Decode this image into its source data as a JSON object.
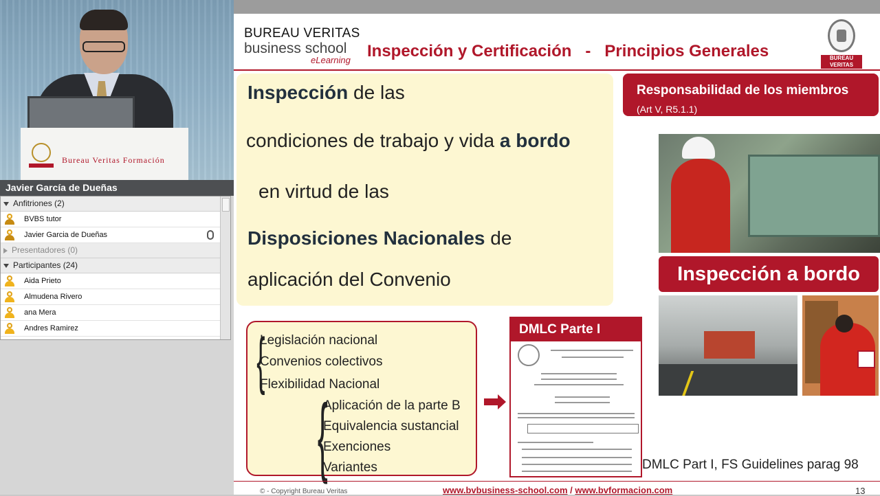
{
  "presenter": {
    "name": "Javier García de Dueñas",
    "lectern_text": "Bureau Veritas Formación"
  },
  "attendees": {
    "groups": [
      {
        "label": "Anfitriones (2)",
        "expanded": true,
        "muted": false
      },
      {
        "label": "Presentadores (0)",
        "expanded": false,
        "muted": true
      },
      {
        "label": "Participantes (24)",
        "expanded": true,
        "muted": false
      }
    ],
    "hosts": [
      "BVBS tutor",
      "Javier Garcia de Dueñas"
    ],
    "participants": [
      "Aida Prieto",
      "Almudena Rivero",
      "ana Mera",
      "Andres Ramirez"
    ]
  },
  "slide": {
    "brand_line1": "BUREAU VERITAS",
    "brand_line2": "business school",
    "brand_line3": "eLearning",
    "title": "Inspección y Certificación   -   Principios Generales",
    "seal_label": "BUREAU VERITAS",
    "main_text": {
      "l1_bold": "Inspección",
      "l1_rest": " de las",
      "l2_rest": "condiciones de trabajo y vida ",
      "l2_bold": "a bordo",
      "l3": "en virtud de las",
      "l4_bold": "Disposiciones Nacionales",
      "l4_rest": " de",
      "l5": "aplicación del Convenio"
    },
    "resp_title": "Responsabilidad de los miembros",
    "resp_sub": "(Art V, R5.1.1)",
    "inspeccion_label": "Inspección a bordo",
    "list_primary": [
      "Legislación nacional",
      "Convenios colectivos",
      "Flexibilidad Nacional"
    ],
    "list_secondary": [
      "Aplicación de la parte B",
      "Equivalencia sustancial",
      "Exenciones",
      "Variantes"
    ],
    "dmlc_title": "DMLC Parte I",
    "guidelines": "DMLC Part I, FS Guidelines parag 98",
    "copyright": "© - Copyright Bureau Veritas",
    "link1": "www.bvbusiness-school.com",
    "link_sep": " / ",
    "link2": "www.bvformacion.com",
    "page_number": "13"
  },
  "colors": {
    "brand_red": "#b0172a",
    "highlight_yellow": "#fdf7d2",
    "name_bar": "#4d4f52"
  }
}
